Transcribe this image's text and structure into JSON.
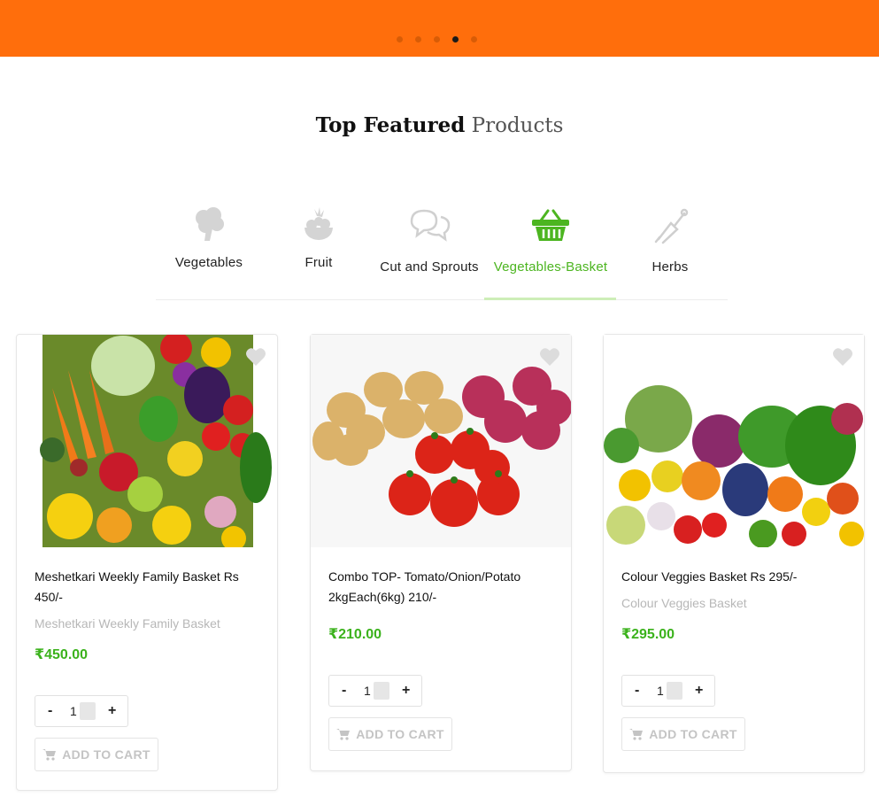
{
  "carousel": {
    "dot_count": 5,
    "active_index": 3
  },
  "section": {
    "title_bold": "Top Featured",
    "title_light": "Products"
  },
  "tabs": [
    {
      "label": "Vegetables",
      "icon": "broccoli-icon"
    },
    {
      "label": "Fruit",
      "icon": "fruit-bowl-icon"
    },
    {
      "label": "Cut and Sprouts",
      "icon": "speech-bubbles-icon"
    },
    {
      "label": "Vegetables-Basket",
      "icon": "basket-icon",
      "active": true
    },
    {
      "label": "Herbs",
      "icon": "mortar-pestle-icon"
    }
  ],
  "products": [
    {
      "title": "Meshetkari Weekly Family Basket Rs 450/-",
      "subtitle": "Meshetkari Weekly Family Basket",
      "price": "₹450.00",
      "quantity": "1",
      "button": "ADD TO CART",
      "image": "mixed-vegetables-image"
    },
    {
      "title": "Combo TOP- Tomato/Onion/Potato 2kgEach(6kg) 210/-",
      "subtitle": "",
      "price": "₹210.00",
      "quantity": "1",
      "button": "ADD TO CART",
      "image": "tomato-onion-potato-image"
    },
    {
      "title": "Colour Veggies Basket Rs 295/-",
      "subtitle": "Colour Veggies Basket",
      "price": "₹295.00",
      "quantity": "1",
      "button": "ADD TO CART",
      "image": "colour-veggies-image"
    }
  ],
  "colors": {
    "banner": "#ff6e0c",
    "accent_green": "#4cb520",
    "price_green": "#3bb21c"
  }
}
